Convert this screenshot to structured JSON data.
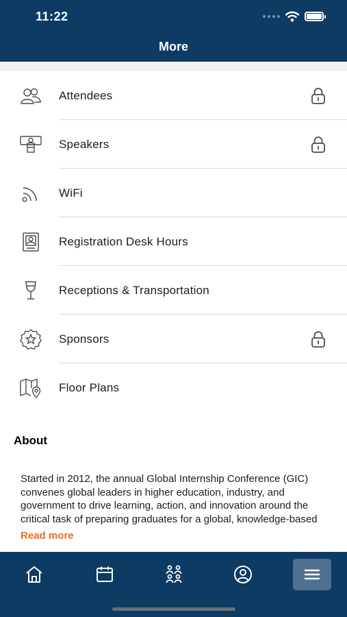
{
  "status_bar": {
    "time": "11:22"
  },
  "header": {
    "title": "More"
  },
  "menu": {
    "items": [
      {
        "label": "Attendees",
        "icon": "attendees-icon",
        "locked": true
      },
      {
        "label": "Speakers",
        "icon": "speaker-podium-icon",
        "locked": true
      },
      {
        "label": "WiFi",
        "icon": "wifi-icon",
        "locked": false
      },
      {
        "label": "Registration Desk Hours",
        "icon": "badge-icon",
        "locked": false
      },
      {
        "label": "Receptions & Transportation",
        "icon": "wine-glass-icon",
        "locked": false
      },
      {
        "label": "Sponsors",
        "icon": "sponsor-star-icon",
        "locked": true
      },
      {
        "label": "Floor Plans",
        "icon": "map-icon",
        "locked": false
      }
    ]
  },
  "about": {
    "heading": "About",
    "text": "Started in 2012, the annual Global Internship Conference (GIC) convenes global leaders in higher education, industry, and government to drive learning, action, and innovation around the critical task of preparing graduates for a global, knowledge-based economy.",
    "read_more": "Read more"
  },
  "tabbar": {
    "tabs": [
      {
        "name": "home",
        "icon": "home-icon",
        "active": false
      },
      {
        "name": "schedule",
        "icon": "calendar-icon",
        "active": false
      },
      {
        "name": "people",
        "icon": "people-icon",
        "active": false
      },
      {
        "name": "profile",
        "icon": "profile-icon",
        "active": false
      },
      {
        "name": "more",
        "icon": "menu-icon",
        "active": true
      }
    ]
  },
  "colors": {
    "header_bg": "#0d3b63",
    "accent": "#ec6b1f",
    "active_tab": "#4f7090"
  }
}
